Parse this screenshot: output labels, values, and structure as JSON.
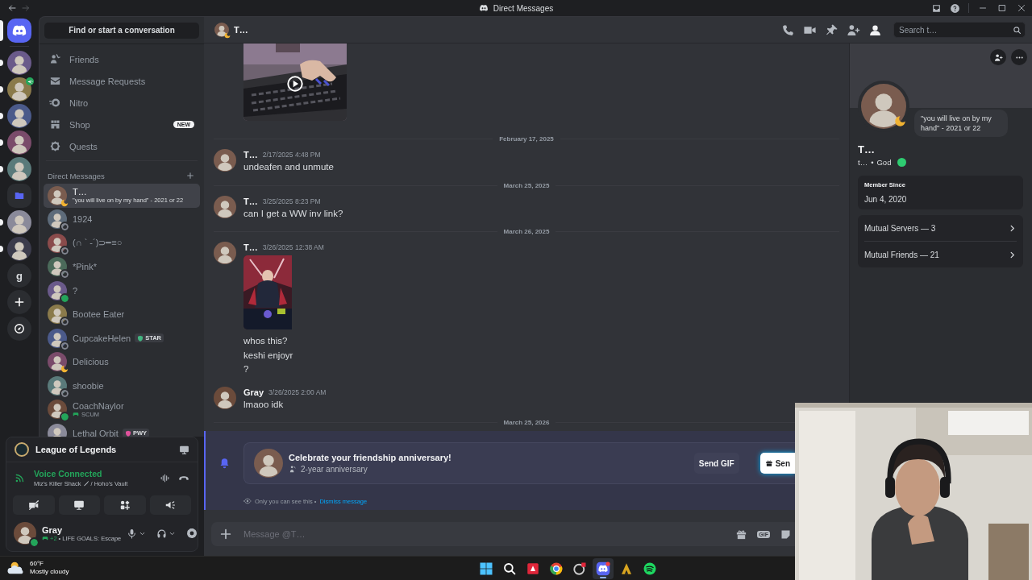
{
  "titlebar": {
    "title": "Direct Messages"
  },
  "servers": [
    {
      "kind": "home",
      "selected": true,
      "unread": false
    },
    {
      "kind": "avatar",
      "selected": false,
      "unread": true,
      "in_voice": false
    },
    {
      "kind": "avatar",
      "selected": false,
      "unread": true,
      "in_voice": true
    },
    {
      "kind": "avatar",
      "selected": false,
      "unread": true,
      "in_voice": false
    },
    {
      "kind": "avatar",
      "selected": false,
      "unread": true,
      "in_voice": false
    },
    {
      "kind": "avatar",
      "selected": false,
      "unread": true,
      "in_voice": false
    },
    {
      "kind": "folder",
      "selected": false,
      "unread": false
    },
    {
      "kind": "avatar",
      "selected": false,
      "unread": true,
      "in_voice": false
    },
    {
      "kind": "avatar",
      "selected": false,
      "unread": true,
      "in_voice": false
    },
    {
      "kind": "letter",
      "label": "g",
      "selected": false,
      "unread": false
    },
    {
      "kind": "add",
      "selected": false,
      "unread": false
    },
    {
      "kind": "discover",
      "selected": false,
      "unread": false
    }
  ],
  "sidebar": {
    "search": "Find or start a conversation",
    "nav": [
      {
        "kind": "friends",
        "label": "Friends",
        "selected": false
      },
      {
        "kind": "requests",
        "label": "Message Requests",
        "selected": false
      },
      {
        "kind": "nitro",
        "label": "Nitro",
        "selected": false
      },
      {
        "kind": "shop",
        "label": "Shop",
        "badge": "NEW",
        "selected": false
      },
      {
        "kind": "quests",
        "label": "Quests",
        "selected": false
      }
    ],
    "dm_header": "Direct Messages",
    "dms": [
      {
        "name": "T…",
        "subtitle": "\"you will live on by my hand\" - 2021 or 22",
        "status": {
          "kind": "moon",
          "color": "#f0b232"
        },
        "selected": true
      },
      {
        "name": "1924",
        "status": {
          "kind": "ring",
          "color": "#80848e"
        },
        "selected": false
      },
      {
        "name": "(∩ ` -´)⊃━≡○",
        "status": {
          "kind": "ring",
          "color": "#80848e"
        },
        "selected": false
      },
      {
        "name": "*Pink*",
        "status": {
          "kind": "ring",
          "color": "#80848e"
        },
        "selected": false
      },
      {
        "name": "?",
        "status": {
          "kind": "dot",
          "color": "#23a55a"
        },
        "selected": false
      },
      {
        "name": "Bootee Eater",
        "status": {
          "kind": "ring",
          "color": "#80848e"
        },
        "selected": false
      },
      {
        "name": "CupcakeHelen",
        "status": {
          "kind": "ring",
          "color": "#80848e"
        },
        "tag": {
          "label": "STAR",
          "color": "#43b581"
        },
        "selected": false
      },
      {
        "name": "Delicious",
        "status": {
          "kind": "moon",
          "color": "#f0b232"
        },
        "selected": false
      },
      {
        "name": "shoobie",
        "status": {
          "kind": "ring",
          "color": "#80848e"
        },
        "selected": false
      },
      {
        "name": "CoachNaylor",
        "status": {
          "kind": "dot",
          "color": "#23a55a"
        },
        "activity": "SCUM",
        "selected": false
      },
      {
        "name": "Lethal Orbit",
        "tag": {
          "label": "PWY",
          "color": "#e0529c"
        },
        "selected": false
      }
    ]
  },
  "userpanel": {
    "activity": {
      "title": "League of Legends"
    },
    "voice": {
      "status": "Voice Connected",
      "channel": "Miz's Killer Shack",
      "server": "/ Hoho's Vault"
    },
    "user": {
      "name": "Gray",
      "status": {
        "kind": "dot",
        "color": "#23a55a"
      },
      "activity_count": "+2",
      "custom_status": "• LIFE GOALS: Escape"
    }
  },
  "chat": {
    "header": {
      "name": "T…",
      "status": {
        "kind": "moon",
        "color": "#f0b232"
      }
    },
    "toolbar": [
      {
        "kind": "call",
        "on": false
      },
      {
        "kind": "video",
        "on": false
      },
      {
        "kind": "pin",
        "on": false
      },
      {
        "kind": "add_friend",
        "on": false
      },
      {
        "kind": "profile",
        "on": true
      }
    ],
    "search": {
      "placeholder": "Search t…"
    },
    "messages": [
      {
        "kind": "continuation",
        "attachment": {
          "kind": "picture",
          "playable": true
        }
      },
      {
        "kind": "divider",
        "label": "February 17, 2025"
      },
      {
        "kind": "message",
        "author": "T…",
        "time": "2/17/2025 4:48 PM",
        "lines": [
          "undeafen and unmute"
        ]
      },
      {
        "kind": "divider",
        "label": "March 25, 2025"
      },
      {
        "kind": "message",
        "author": "T…",
        "time": "3/25/2025 8:23 PM",
        "lines": [
          "can I get a WW inv link?"
        ]
      },
      {
        "kind": "divider",
        "label": "March 26, 2025"
      },
      {
        "kind": "message",
        "author": "T…",
        "time": "3/26/2025 12:38 AM",
        "attachment": {
          "kind": "picture",
          "playable": false
        },
        "lines": [
          "whos this?",
          "keshi enjoyr",
          "?"
        ]
      },
      {
        "kind": "message",
        "author": "Gray",
        "time": "3/26/2025 2:00 AM",
        "lines": [
          "lmaoo idk"
        ]
      },
      {
        "kind": "divider",
        "label": "March 25, 2026"
      },
      {
        "kind": "anniversary",
        "title": "Celebrate your friendship anniversary!",
        "subtitle": "2-year anniversary",
        "buttons": [
          {
            "kind": "secondary",
            "label": "Send GIF"
          },
          {
            "kind": "primary",
            "label": "Sen"
          }
        ],
        "note": "Only you can see this •",
        "link": "Dismiss message"
      }
    ],
    "composer": {
      "placeholder": "Message @T…",
      "tools": [
        {
          "kind": "gift"
        },
        {
          "kind": "gif",
          "label": "GIF"
        },
        {
          "kind": "sticker"
        }
      ]
    }
  },
  "profile": {
    "status": {
      "kind": "moon",
      "color": "#f0b232"
    },
    "bio": "\"you will live on by my hand\" - 2021 or 22",
    "name": "T…",
    "username": "t…",
    "separator": "•",
    "tag": "God",
    "member_since": {
      "label": "Member Since",
      "date": "Jun 4, 2020"
    },
    "mutuals": [
      {
        "label": "Mutual Servers — 3"
      },
      {
        "label": "Mutual Friends — 21"
      }
    ]
  },
  "taskbar": {
    "weather": {
      "temp": "60°F",
      "desc": "Mostly cloudy"
    },
    "apps": [
      {
        "kind": "start",
        "active": false
      },
      {
        "kind": "search",
        "active": false
      },
      {
        "kind": "red_app",
        "active": false
      },
      {
        "kind": "browser",
        "active": false
      },
      {
        "kind": "app",
        "active": false
      },
      {
        "kind": "chat",
        "active": true
      },
      {
        "kind": "game",
        "active": false
      },
      {
        "kind": "music",
        "active": false
      }
    ]
  },
  "webcam": {
    "kind": "picture"
  }
}
